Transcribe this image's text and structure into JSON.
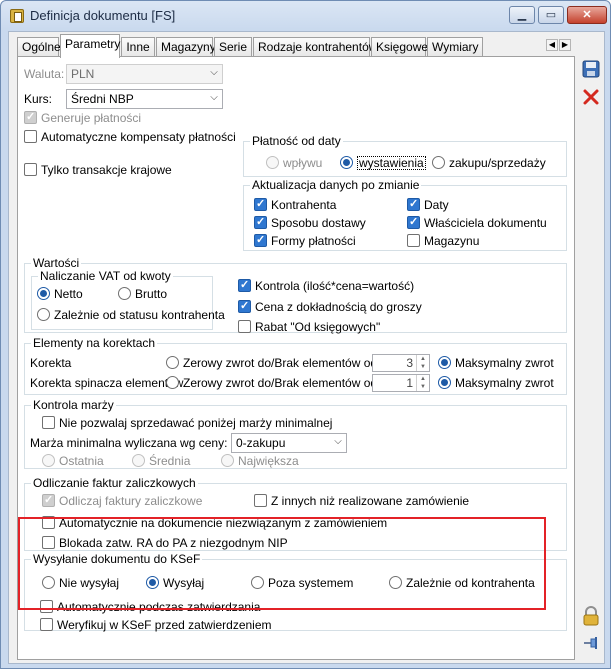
{
  "window": {
    "title": "Definicja dokumentu [FS]"
  },
  "tabs": [
    "Ogólne",
    "Parametry",
    "Inne",
    "Magazyny",
    "Serie",
    "Rodzaje kontrahentów",
    "Księgowe",
    "Wymiary"
  ],
  "waluta": {
    "label": "Waluta:",
    "value": "PLN"
  },
  "kurs": {
    "label": "Kurs:",
    "value": "Średni NBP"
  },
  "checks_top": {
    "generuje": "Generuje płatności",
    "kompensaty": "Automatyczne kompensaty płatności",
    "krajowe": "Tylko transakcje krajowe"
  },
  "platnosc": {
    "title": "Płatność od daty",
    "options": [
      "wpływu",
      "wystawienia",
      "zakupu/sprzedaży"
    ]
  },
  "aktualizacja": {
    "title": "Aktualizacja danych po zmianie",
    "items": [
      "Kontrahenta",
      "Daty",
      "Sposobu dostawy",
      "Właściciela dokumentu",
      "Formy płatności",
      "Magazynu"
    ]
  },
  "wartosci": {
    "title": "Wartości",
    "vat_title": "Naliczanie VAT od kwoty",
    "netto": "Netto",
    "brutto": "Brutto",
    "zaleznie": "Zależnie od statusu kontrahenta",
    "kontrola": "Kontrola (ilość*cena=wartość)",
    "cena": "Cena z dokładnością do groszy",
    "rabat": "Rabat \"Od księgowych\""
  },
  "korekty": {
    "title": "Elementy na korektach",
    "korekta": "Korekta",
    "spinacz": "Korekta spinacza elementów",
    "zerowy": "Zerowy zwrot do/Brak elementów od:",
    "maks": "Maksymalny zwrot",
    "value1": "3",
    "value2": "1"
  },
  "marza": {
    "title": "Kontrola marży",
    "nie_pozwalaj": "Nie pozwalaj sprzedawać poniżej marży minimalnej",
    "wyliczana": "Marża minimalna wyliczana wg ceny:",
    "combo": "0-zakupu",
    "opts": [
      "Ostatnia",
      "Średnia",
      "Największa"
    ]
  },
  "zaliczki": {
    "title": "Odliczanie faktur zaliczkowych",
    "odliczaj": "Odliczaj faktury zaliczkowe",
    "z_innych": "Z innych niż realizowane zamówienie",
    "auto": "Automatycznie na dokumencie niezwiązanym z zamówieniem",
    "blokada": "Blokada zatw. RA do PA z niezgodnym NIP"
  },
  "ksef": {
    "title": "Wysyłanie dokumentu do KSeF",
    "options": [
      "Nie wysyłaj",
      "Wysyłaj",
      "Poza systemem",
      "Zależnie od kontrahenta"
    ],
    "auto": "Automatycznie podczas zatwierdzania",
    "weryfikuj": "Weryfikuj w KSeF przed zatwierdzeniem"
  },
  "colors": {
    "highlight": "#e32227",
    "accent": "#1e5aa6"
  }
}
